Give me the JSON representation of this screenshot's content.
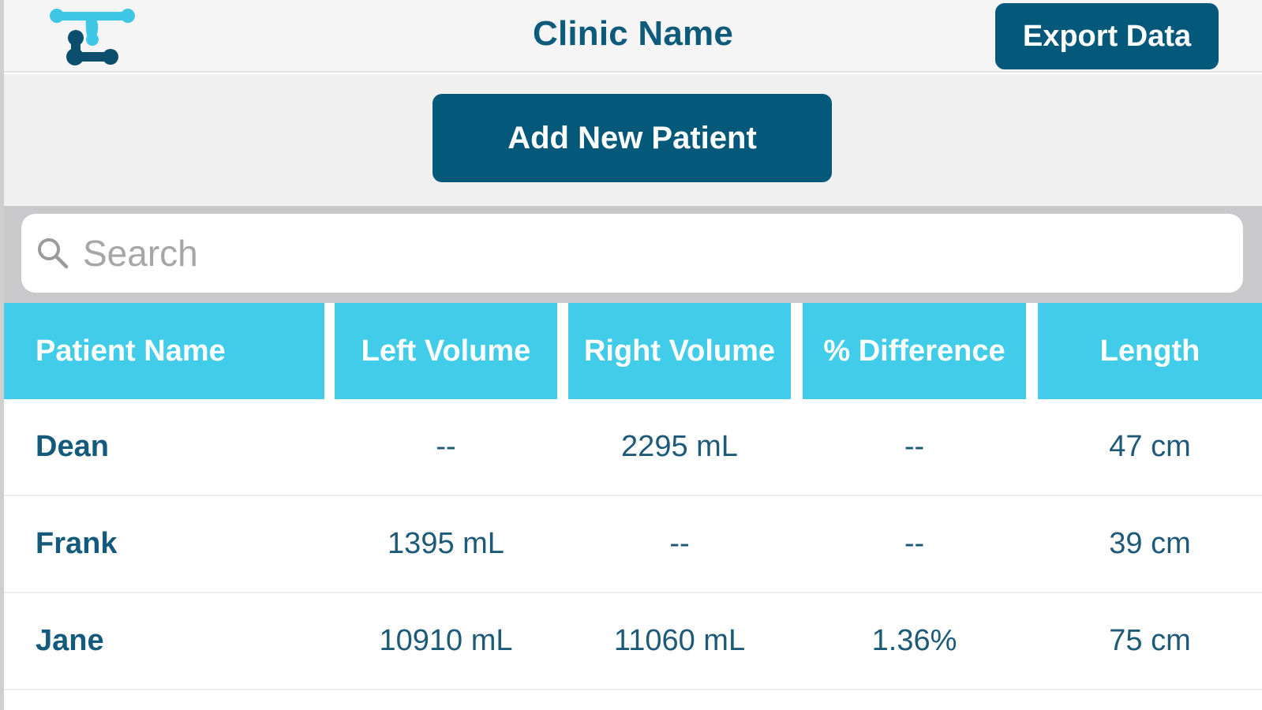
{
  "navbar": {
    "title": "Clinic Name",
    "export_label": "Export Data",
    "logo_icon": "clinic-logo-icon"
  },
  "actions": {
    "add_patient_label": "Add New Patient"
  },
  "search": {
    "placeholder": "Search",
    "value": "",
    "icon": "search-icon"
  },
  "table": {
    "columns": [
      "Patient Name",
      "Left Volume",
      "Right Volume",
      "% Difference",
      "Length"
    ],
    "rows": [
      {
        "name": "Dean",
        "left_volume": "--",
        "right_volume": "2295 mL",
        "difference": "--",
        "length": "47 cm"
      },
      {
        "name": "Frank",
        "left_volume": "1395 mL",
        "right_volume": "--",
        "difference": "--",
        "length": "39 cm"
      },
      {
        "name": "Jane",
        "left_volume": "10910 mL",
        "right_volume": "11060 mL",
        "difference": "1.36%",
        "length": "75 cm"
      }
    ]
  },
  "colors": {
    "primary": "#04587a",
    "header": "#41cde9",
    "text": "#1d5a78",
    "logo_light": "#3fc7e6",
    "logo_dark": "#0a4f6e"
  }
}
